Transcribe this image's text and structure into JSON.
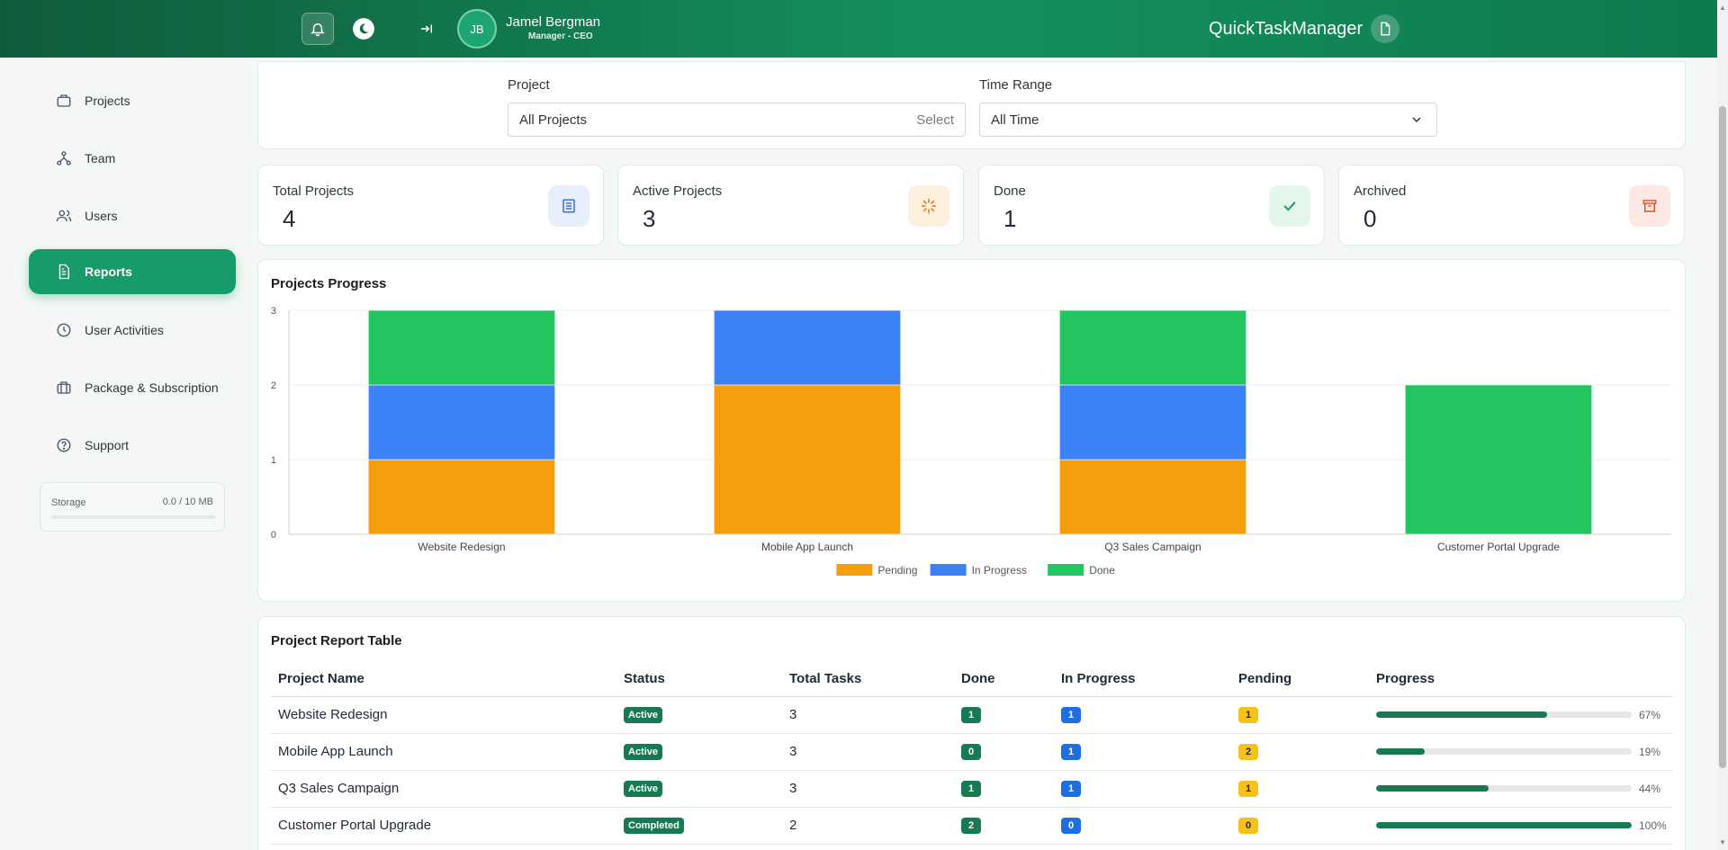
{
  "topbar": {
    "avatar_initials": "JB",
    "user_name": "Jamel Bergman",
    "user_role": "Manager - CEO",
    "brand": "QuickTaskManager",
    "icons": [
      "bell-icon",
      "moon-icon",
      "collapse-icon",
      "document-icon"
    ]
  },
  "sidebar": {
    "items": [
      {
        "label": "Projects",
        "icon": "briefcase-icon"
      },
      {
        "label": "Team",
        "icon": "network-icon"
      },
      {
        "label": "Users",
        "icon": "users-icon"
      },
      {
        "label": "Reports",
        "icon": "report-icon",
        "active": true
      },
      {
        "label": "User Activities",
        "icon": "clock-icon"
      },
      {
        "label": "Package & Subscription",
        "icon": "package-icon"
      },
      {
        "label": "Support",
        "icon": "help-icon"
      }
    ],
    "storage": {
      "label": "Storage",
      "value": "0.0 / 10 MB",
      "fraction": 0
    }
  },
  "filters": {
    "project_label": "Project",
    "project_value": "All Projects",
    "project_hint": "Select",
    "time_label": "Time Range",
    "time_value": "All Time"
  },
  "stats": [
    {
      "label": "Total Projects",
      "value": "4",
      "icon": "list-icon",
      "color": "#3b6fd1"
    },
    {
      "label": "Active Projects",
      "value": "3",
      "icon": "spinner-icon",
      "color": "#e8861a"
    },
    {
      "label": "Done",
      "value": "1",
      "icon": "check-icon",
      "color": "#1f9d55"
    },
    {
      "label": "Archived",
      "value": "0",
      "icon": "archive-icon",
      "color": "#e0552b"
    }
  ],
  "chart": {
    "title": "Projects Progress"
  },
  "chart_data": {
    "type": "bar",
    "stacked": true,
    "categories": [
      "Website Redesign",
      "Mobile App Launch",
      "Q3 Sales Campaign",
      "Customer Portal Upgrade"
    ],
    "series": [
      {
        "name": "Pending",
        "values": [
          1,
          2,
          1,
          0
        ],
        "color": "#f59e0b"
      },
      {
        "name": "In Progress",
        "values": [
          1,
          1,
          1,
          0
        ],
        "color": "#3b82f6"
      },
      {
        "name": "Done",
        "values": [
          1,
          0,
          1,
          2
        ],
        "color": "#22c55e"
      }
    ],
    "ylim": [
      0,
      3
    ],
    "yticks": [
      0,
      1,
      2,
      3
    ],
    "grid": true,
    "legend": "bottom"
  },
  "table": {
    "title": "Project Report Table",
    "headers": [
      "Project Name",
      "Status",
      "Total Tasks",
      "Done",
      "In Progress",
      "Pending",
      "Progress"
    ],
    "rows": [
      {
        "name": "Website Redesign",
        "status": "Active",
        "total": "3",
        "done": "1",
        "in_progress": "1",
        "pending": "1",
        "progress": 67,
        "progress_label": "67%"
      },
      {
        "name": "Mobile App Launch",
        "status": "Active",
        "total": "3",
        "done": "0",
        "in_progress": "1",
        "pending": "2",
        "progress": 19,
        "progress_label": "19%"
      },
      {
        "name": "Q3 Sales Campaign",
        "status": "Active",
        "total": "3",
        "done": "1",
        "in_progress": "1",
        "pending": "1",
        "progress": 44,
        "progress_label": "44%"
      },
      {
        "name": "Customer Portal Upgrade",
        "status": "Completed",
        "total": "2",
        "done": "2",
        "in_progress": "0",
        "pending": "0",
        "progress": 100,
        "progress_label": "100%"
      }
    ]
  },
  "colors": {
    "accent": "#169b69",
    "status_active": "#177a52",
    "pill_done": "#177a52",
    "pill_progress": "#1d6fe0",
    "pill_pending": "#f5c21b"
  }
}
